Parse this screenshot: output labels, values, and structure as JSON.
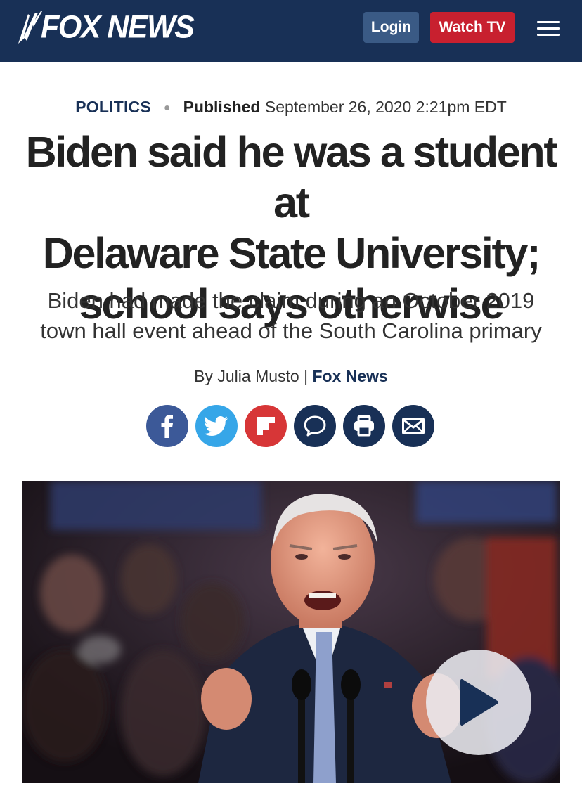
{
  "header": {
    "brand": "FOX NEWS",
    "login_label": "Login",
    "watch_label": "Watch TV",
    "menu_icon": "hamburger-menu-icon",
    "colors": {
      "background": "#183056",
      "login": "#3a5a85",
      "watch": "#c8202f"
    }
  },
  "article": {
    "category": "POLITICS",
    "published_label": "Published",
    "published_date": "September 26, 2020 2:21pm EDT",
    "headline_lines": [
      "Biden said he was a student at",
      "Delaware State University;",
      "school says otherwise"
    ],
    "subhead_lines": [
      "Biden had made the claim during an October 2019",
      "town hall event ahead of the South Carolina primary"
    ],
    "byline_prefix": "By Julia Musto | ",
    "byline_source": "Fox News"
  },
  "share": [
    {
      "name": "facebook-icon",
      "color": "#3c5998"
    },
    {
      "name": "twitter-icon",
      "color": "#36a6e8"
    },
    {
      "name": "flipboard-icon",
      "color": "#d73637"
    },
    {
      "name": "comments-icon",
      "color": "#183056"
    },
    {
      "name": "print-icon",
      "color": "#183056"
    },
    {
      "name": "email-icon",
      "color": "#183056"
    }
  ],
  "media": {
    "play_icon": "play-icon"
  }
}
